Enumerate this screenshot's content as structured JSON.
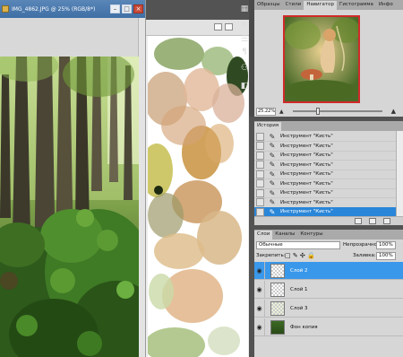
{
  "document": {
    "window_title": "IMG_4862.JPG @ 25% (RGB/8*)",
    "window_buttons": [
      "–",
      "□",
      "×"
    ]
  },
  "navigator": {
    "tabs": [
      "Образцы",
      "Стили",
      "Навигатор",
      "Гистограмма",
      "Инфо"
    ],
    "active_tab": "Навигатор",
    "zoom_value": "25.22%",
    "zoom_level": 0.26
  },
  "toolbar_icons": [
    "brush-panel-icon",
    "adjust-icon",
    "character-icon",
    "paragraph-icon",
    "clone-icon",
    "tool-presets-icon"
  ],
  "history": {
    "tab_label": "История",
    "items": [
      "Инструмент \"Кисть\"",
      "Инструмент \"Кисть\"",
      "Инструмент \"Кисть\"",
      "Инструмент \"Кисть\"",
      "Инструмент \"Кисть\"",
      "Инструмент \"Кисть\"",
      "Инструмент \"Кисть\"",
      "Инструмент \"Кисть\"",
      "Инструмент \"Кисть\""
    ],
    "selected_index": 8
  },
  "layers": {
    "tabs": [
      "Слои",
      "Каналы",
      "Контуры"
    ],
    "active_tab": "Слои",
    "blend_mode": "Обычные",
    "opacity_label": "Непрозрачность:",
    "opacity_value": "100%",
    "lock_label": "Закрепить:",
    "fill_label": "Заливка:",
    "fill_value": "100%",
    "items": [
      {
        "name": "Слой 2",
        "selected": true,
        "thumb": "checker"
      },
      {
        "name": "Слой 1",
        "selected": false,
        "thumb": "checker"
      },
      {
        "name": "Слой 3",
        "selected": false,
        "thumb": "plant"
      },
      {
        "name": "Фон копия",
        "selected": false,
        "thumb": "green"
      }
    ]
  },
  "colors": {
    "selection_blue": "#3a98ea",
    "title_blue": "#4a7bb3",
    "panel_gray": "#d6d6d6",
    "app_gray": "#535353"
  }
}
